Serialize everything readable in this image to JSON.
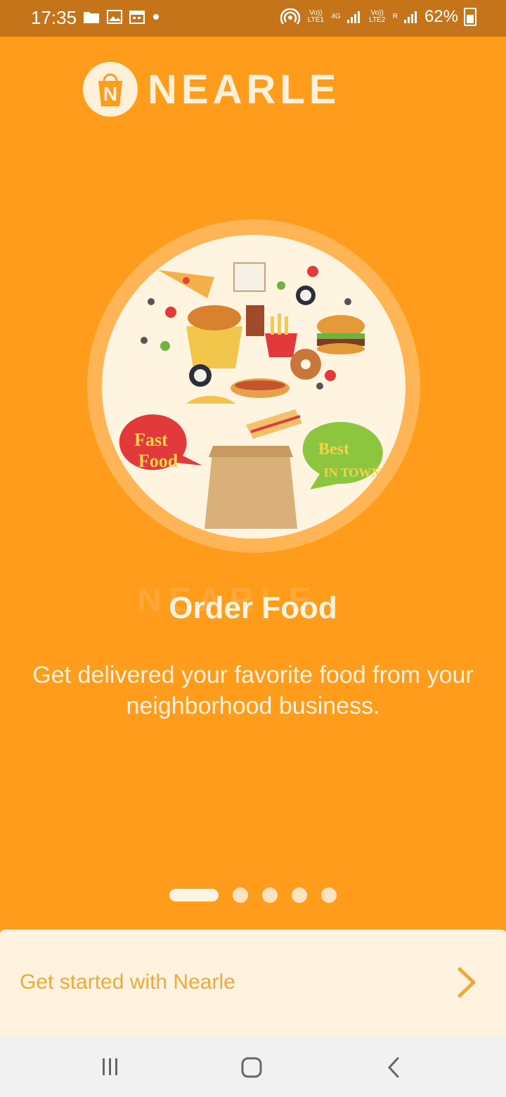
{
  "status": {
    "time": "17:35",
    "left_icons": [
      "folder-icon",
      "image-icon",
      "calendar-icon",
      "dot-icon"
    ],
    "right_icons": [
      "hotspot-icon",
      "volte1-icon",
      "signal1-icon",
      "volte2-icon",
      "signal2-icon",
      "battery-icon"
    ],
    "sim1_label": "Vo)) LTE1",
    "sim2_label": "Vo)) LTE2",
    "network_label": "4G",
    "roaming_label": "R",
    "battery": "62%"
  },
  "brand": {
    "name": "NEARLE",
    "mark": "N",
    "watermark": "NEARLE"
  },
  "onboarding": {
    "title": "Order Food",
    "description": "Get delivered your favorite food from your neighborhood business.",
    "badges": {
      "fast_line1": "Fast",
      "fast_line2": "Food",
      "best_line1": "Best",
      "best_line2": "IN TOWN"
    },
    "page_count": 5,
    "current_page": 1
  },
  "cta": {
    "label": "Get started with Nearle"
  },
  "colors": {
    "background": "#FF9C1C",
    "status_bar": "#C5741A",
    "cta_bg": "#FFF3DF",
    "cta_text": "#EFA83A"
  }
}
